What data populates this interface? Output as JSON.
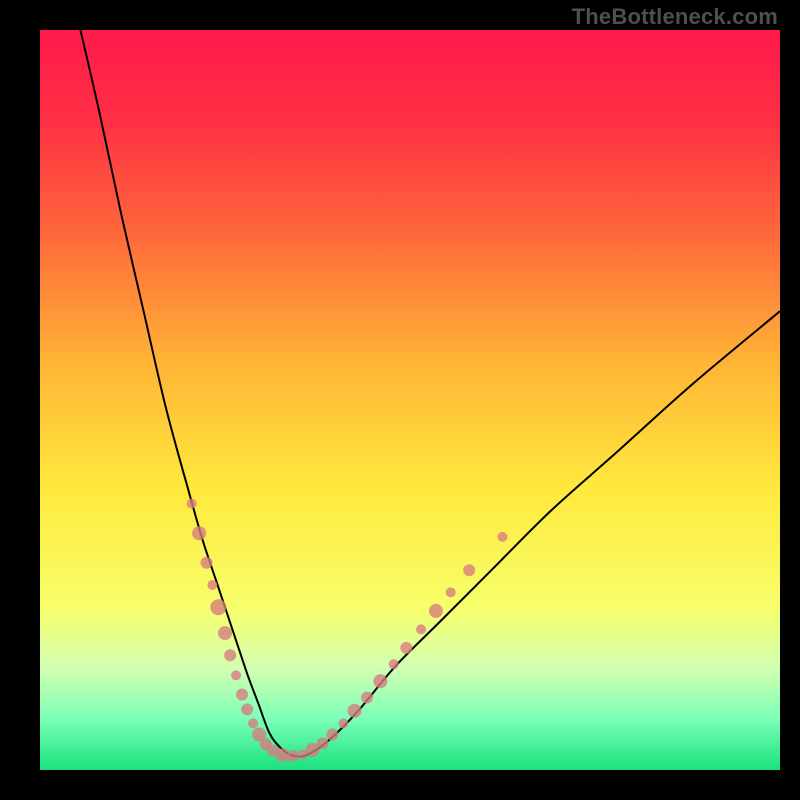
{
  "watermark": "TheBottleneck.com",
  "gradient": {
    "stops": [
      {
        "pct": 0,
        "color": "#ff1a4b"
      },
      {
        "pct": 12,
        "color": "#ff2f45"
      },
      {
        "pct": 28,
        "color": "#ff6a3a"
      },
      {
        "pct": 45,
        "color": "#ffb436"
      },
      {
        "pct": 62,
        "color": "#ffe93d"
      },
      {
        "pct": 78,
        "color": "#f6ff6a"
      },
      {
        "pct": 86,
        "color": "#d4ffb0"
      },
      {
        "pct": 93,
        "color": "#7dffb8"
      },
      {
        "pct": 100,
        "color": "#19e27d"
      }
    ]
  },
  "chart_data": {
    "type": "line",
    "title": "",
    "xlabel": "",
    "ylabel": "",
    "xlim": [
      0,
      100
    ],
    "ylim": [
      0,
      100
    ],
    "series": [
      {
        "name": "curve",
        "x": [
          5,
          8,
          11,
          14,
          17,
          20,
          22,
          24,
          26,
          28,
          29.5,
          31,
          32.5,
          34,
          36,
          39,
          43,
          48,
          54,
          61,
          69,
          78,
          88,
          100
        ],
        "y": [
          102,
          89,
          75,
          62,
          49,
          38,
          31,
          25,
          19,
          13,
          9,
          5,
          3,
          2,
          2,
          4,
          8,
          14,
          20,
          27,
          35,
          43,
          52,
          62
        ]
      }
    ],
    "scatter": {
      "name": "dots",
      "points": [
        {
          "x": 20.5,
          "y": 36,
          "r": 5
        },
        {
          "x": 21.5,
          "y": 32,
          "r": 7
        },
        {
          "x": 22.5,
          "y": 28,
          "r": 6
        },
        {
          "x": 23.3,
          "y": 25,
          "r": 5
        },
        {
          "x": 24.1,
          "y": 22,
          "r": 8
        },
        {
          "x": 25.0,
          "y": 18.5,
          "r": 7
        },
        {
          "x": 25.7,
          "y": 15.5,
          "r": 6
        },
        {
          "x": 26.5,
          "y": 12.8,
          "r": 5
        },
        {
          "x": 27.3,
          "y": 10.2,
          "r": 6
        },
        {
          "x": 28.0,
          "y": 8.2,
          "r": 6
        },
        {
          "x": 28.8,
          "y": 6.3,
          "r": 5
        },
        {
          "x": 29.6,
          "y": 4.8,
          "r": 7
        },
        {
          "x": 30.5,
          "y": 3.5,
          "r": 6
        },
        {
          "x": 31.5,
          "y": 2.6,
          "r": 6
        },
        {
          "x": 32.8,
          "y": 2.0,
          "r": 7
        },
        {
          "x": 34.2,
          "y": 1.9,
          "r": 6
        },
        {
          "x": 35.5,
          "y": 2.1,
          "r": 5
        },
        {
          "x": 36.8,
          "y": 2.7,
          "r": 7
        },
        {
          "x": 38.2,
          "y": 3.6,
          "r": 6
        },
        {
          "x": 39.5,
          "y": 4.8,
          "r": 6
        },
        {
          "x": 41.0,
          "y": 6.3,
          "r": 5
        },
        {
          "x": 42.5,
          "y": 8.0,
          "r": 7
        },
        {
          "x": 44.2,
          "y": 9.8,
          "r": 6
        },
        {
          "x": 46.0,
          "y": 12.0,
          "r": 7
        },
        {
          "x": 47.8,
          "y": 14.3,
          "r": 5
        },
        {
          "x": 49.5,
          "y": 16.5,
          "r": 6
        },
        {
          "x": 51.5,
          "y": 19.0,
          "r": 5
        },
        {
          "x": 53.5,
          "y": 21.5,
          "r": 7
        },
        {
          "x": 55.5,
          "y": 24.0,
          "r": 5
        },
        {
          "x": 58.0,
          "y": 27.0,
          "r": 6
        },
        {
          "x": 62.5,
          "y": 31.5,
          "r": 5
        }
      ]
    }
  }
}
